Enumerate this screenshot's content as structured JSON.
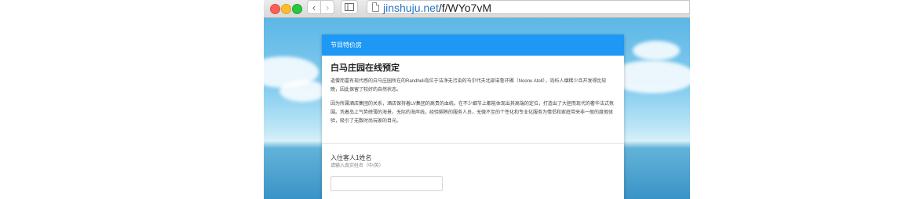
{
  "browser": {
    "url_host": "jinshuju.net",
    "url_path": "/f/WYo7vM"
  },
  "form": {
    "header": "节目特价房",
    "title": "白马庄园在线预定",
    "paragraphs": [
      "道僧而富有现代感的白马庄园所在的Randheli岛位于洁净无污染的马尔代夫北部诺鲁环礁（Noonu Atoll），岛屿人烟稀少且开发得比较晚，因此保留了较好的自然状态。",
      "因为所属酒店集团的关系，酒店保持着LV集团的高贵的血统。在不少细节上都能体现出其高端的定位，打造出了大胆而现代的奢华法式氛围。凭着岛上气势磅薄的海景，无际的海岸线，经验娴熟的服务人员，无微不至的个性化和专业化服务为情侣和家庭带来非一般的度假体验，吸引了无数时尚玩家的目光。"
    ],
    "field": {
      "label": "入住客人1姓名",
      "hint": "请输入真实姓名（中/英）"
    }
  }
}
